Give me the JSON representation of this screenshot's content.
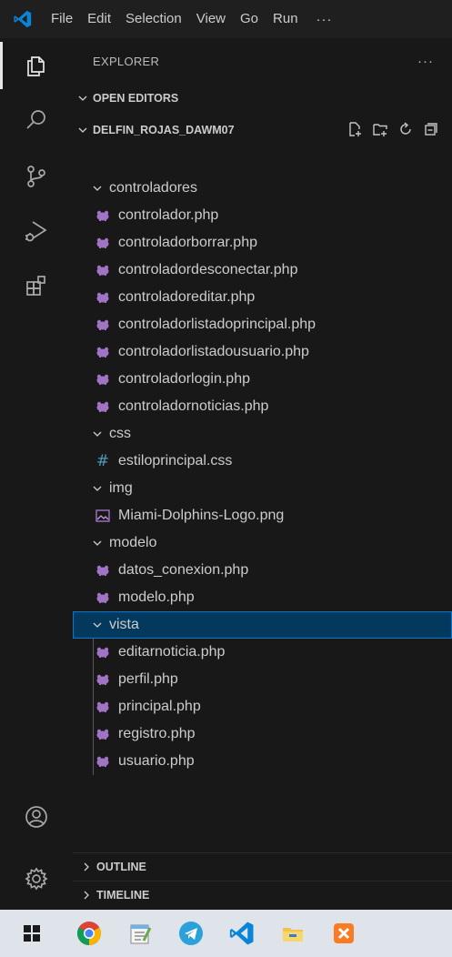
{
  "menu": [
    "File",
    "Edit",
    "Selection",
    "View",
    "Go",
    "Run"
  ],
  "menu_more": "···",
  "explorer": {
    "title": "EXPLORER",
    "more": "···"
  },
  "sections": {
    "open_editors": "OPEN EDITORS",
    "project": "DELFIN_ROJAS_DAWM07",
    "outline": "OUTLINE",
    "timeline": "TIMELINE"
  },
  "tree": [
    {
      "type": "folder",
      "label": "controladores"
    },
    {
      "type": "php",
      "label": "controlador.php"
    },
    {
      "type": "php",
      "label": "controladorborrar.php"
    },
    {
      "type": "php",
      "label": "controladordesconectar.php"
    },
    {
      "type": "php",
      "label": "controladoreditar.php"
    },
    {
      "type": "php",
      "label": "controladorlistadoprincipal.php"
    },
    {
      "type": "php",
      "label": "controladorlistadousuario.php"
    },
    {
      "type": "php",
      "label": "controladorlogin.php"
    },
    {
      "type": "php",
      "label": "controladornoticias.php"
    },
    {
      "type": "folder",
      "label": "css"
    },
    {
      "type": "css",
      "label": "estiloprincipal.css"
    },
    {
      "type": "folder",
      "label": "img"
    },
    {
      "type": "png",
      "label": "Miami-Dolphins-Logo.png"
    },
    {
      "type": "folder",
      "label": "modelo"
    },
    {
      "type": "php",
      "label": "datos_conexion.php"
    },
    {
      "type": "php",
      "label": "modelo.php"
    },
    {
      "type": "folder",
      "label": "vista",
      "selected": true
    },
    {
      "type": "php",
      "label": "editarnoticia.php"
    },
    {
      "type": "php",
      "label": "perfil.php"
    },
    {
      "type": "php",
      "label": "principal.php"
    },
    {
      "type": "php",
      "label": "registro.php"
    },
    {
      "type": "php",
      "label": "usuario.php"
    }
  ],
  "colors": {
    "accent": "#0078d4",
    "selection": "#04395e",
    "php_icon": "#a074c4",
    "css_icon": "#519aba",
    "vscode_blue": "#0a84d6"
  },
  "taskbar_icons": [
    "windows-start",
    "chrome",
    "notepad",
    "telegram",
    "vscode",
    "file-explorer",
    "xampp"
  ]
}
